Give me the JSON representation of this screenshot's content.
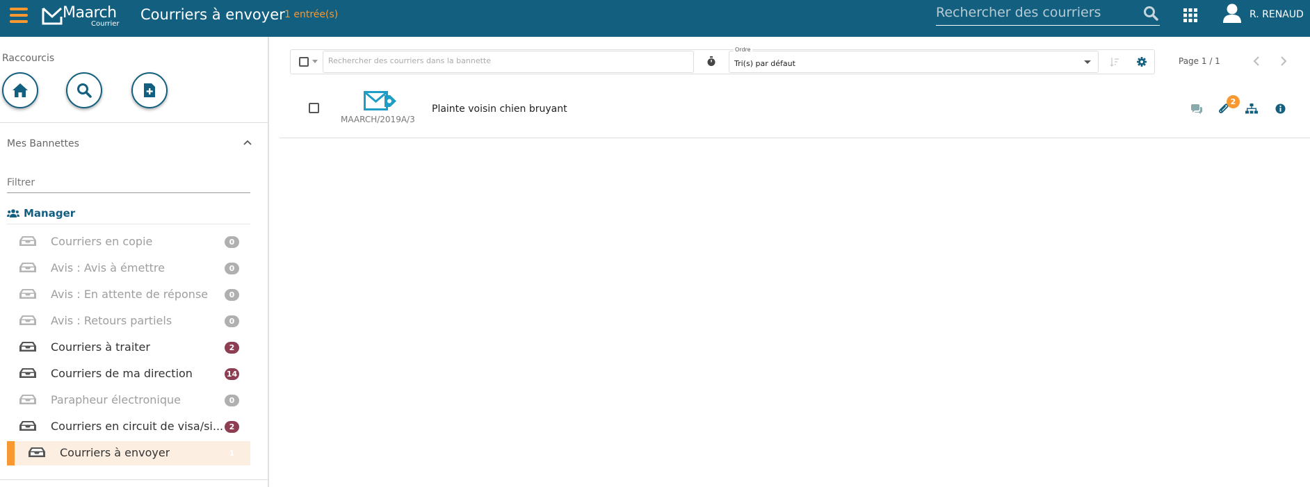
{
  "header": {
    "logo_text": "Maarch",
    "logo_sub": "Courrier",
    "title": "Courriers à envoyer",
    "entries": "1 entrée(s)",
    "search_placeholder": "Rechercher des courriers",
    "user": "R. RENAUD"
  },
  "sidebar": {
    "shortcuts_title": "Raccourcis",
    "shortcuts": [
      {
        "name": "home-icon"
      },
      {
        "name": "search-icon"
      },
      {
        "name": "new-document-icon"
      }
    ],
    "baskets_title": "Mes Bannettes",
    "filter_placeholder": "Filtrer",
    "group": "Manager",
    "baskets": [
      {
        "label": "Courriers en copie",
        "count": "0",
        "state": "disabled"
      },
      {
        "label": "Avis : Avis à émettre",
        "count": "0",
        "state": "disabled"
      },
      {
        "label": "Avis : En attente de réponse",
        "count": "0",
        "state": "disabled"
      },
      {
        "label": "Avis : Retours partiels",
        "count": "0",
        "state": "disabled"
      },
      {
        "label": "Courriers à traiter",
        "count": "2",
        "state": "enabled"
      },
      {
        "label": "Courriers de ma direction",
        "count": "14",
        "state": "enabled"
      },
      {
        "label": "Parapheur électronique",
        "count": "0",
        "state": "disabled"
      },
      {
        "label": "Courriers en circuit de visa/si...",
        "count": "2",
        "state": "enabled"
      },
      {
        "label": "Courriers à envoyer",
        "count": "1",
        "state": "active"
      }
    ]
  },
  "toolbar": {
    "search_placeholder": "Rechercher des courriers dans la bannette",
    "order_label": "Ordre",
    "order_value": "Tri(s) par défaut",
    "page_info": "Page 1 / 1"
  },
  "list": [
    {
      "ref": "MAARCH/2019A/3",
      "subject": "Plainte voisin chien bruyant",
      "attachments": "2"
    }
  ],
  "colors": {
    "primary": "#135f7f",
    "accent": "#f99830",
    "badge": "#8e3e52",
    "mail_icon": "#1e9ec6"
  }
}
